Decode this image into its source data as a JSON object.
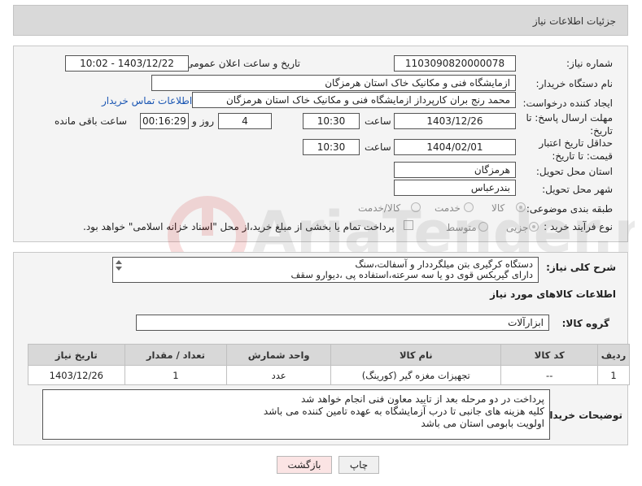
{
  "header": {
    "title": "جزئیات اطلاعات نیاز"
  },
  "form": {
    "need_number": {
      "label": "شماره نیاز:",
      "value": "1103090820000078"
    },
    "announce_datetime": {
      "label": "تاریخ و ساعت اعلان عمومی:",
      "value": "1403/12/22 - 10:02"
    },
    "buyer_org": {
      "label": "نام دستگاه خریدار:",
      "value": "ازمایشگاه فنی و مکانیک خاک استان هرمزگان"
    },
    "requester": {
      "label": "ایجاد کننده درخواست:",
      "value": "محمد رنج بران کارپرداز ازمایشگاه فنی و مکانیک خاک استان هرمزگان",
      "contact_link": "اطلاعات تماس خریدار"
    },
    "reply_deadline": {
      "label": "مهلت ارسال پاسخ: تا تاریخ:",
      "date": "1403/12/26",
      "time_label": "ساعت",
      "time": "10:30",
      "days": "4",
      "days_label": "روز و",
      "remaining": "00:16:29",
      "remaining_label": "ساعت باقی مانده"
    },
    "price_validity": {
      "label": "حداقل تاریخ اعتبار قیمت: تا تاریخ:",
      "date": "1404/02/01",
      "time_label": "ساعت",
      "time": "10:30"
    },
    "province": {
      "label": "استان محل تحویل:",
      "value": "هرمزگان"
    },
    "city": {
      "label": "شهر محل تحویل:",
      "value": "بندرعباس"
    },
    "category": {
      "label": "طبقه بندی موضوعی:",
      "options": [
        "کالا",
        "خدمت",
        "کالا/خدمت"
      ]
    },
    "purchase_type": {
      "label": "نوع فرآیند خرید :",
      "options": [
        "جزیی",
        "متوسط"
      ],
      "payment_note": "پرداخت تمام یا بخشی از مبلغ خرید،از محل \"اسناد خزانه اسلامی\" خواهد بود."
    }
  },
  "description": {
    "label": "شرح کلی نیاز:",
    "lines": [
      "دستگاه کرگیری بتن میلگرددار و آسفالت،سنگ",
      "دارای گیربکس قوی دو یا سه سرعته،استفاده پی ،دیوارو سقف"
    ]
  },
  "goods_section": {
    "title": "اطلاعات کالاهای مورد نیاز",
    "group_label": "گروه کالا:",
    "group_value": "ابزارآلات"
  },
  "items_table": {
    "headers": [
      "ردیف",
      "کد کالا",
      "نام کالا",
      "واحد شمارش",
      "تعداد / مقدار",
      "تاریخ نیاز"
    ],
    "rows": [
      [
        "1",
        "--",
        "تجهیزات مغزه گیر (کورینگ)",
        "عدد",
        "1",
        "1403/12/26"
      ]
    ]
  },
  "buyer_notes": {
    "label": "توضیحات خریدار:",
    "lines": [
      "پرداخت در دو مرحله بعد از تایید معاون فنی انجام خواهد شد",
      "کلیه هزینه های جانبی تا درب آزمایشگاه به عهده تامین کننده می باشد",
      "اولویت بابومی استان می باشد"
    ]
  },
  "buttons": {
    "print": "چاپ",
    "back": "بازگشت"
  },
  "watermark": {
    "text": "AriaTender.neT"
  }
}
